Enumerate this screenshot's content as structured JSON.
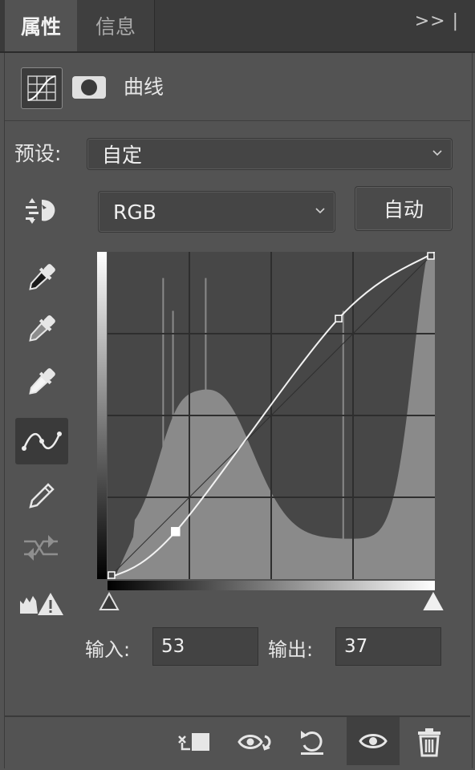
{
  "tabs": [
    {
      "label": "属性",
      "active": true
    },
    {
      "label": "信息",
      "active": false
    }
  ],
  "panel_menu_label": ">> |",
  "adjustment": {
    "title": "曲线",
    "type_icon": "curves-adjustment-icon",
    "mask_icon": "layer-mask-icon"
  },
  "preset": {
    "label": "预设:",
    "value": "自定"
  },
  "channel": {
    "value": "RGB",
    "auto_label": "自动"
  },
  "tools": [
    {
      "name": "on-image-adjust-icon",
      "active": false
    },
    {
      "name": "black-point-eyedropper-icon",
      "active": false
    },
    {
      "name": "gray-point-eyedropper-icon",
      "active": false
    },
    {
      "name": "white-point-eyedropper-icon",
      "active": false
    },
    {
      "name": "edit-points-curve-icon",
      "active": true
    },
    {
      "name": "pencil-draw-icon",
      "active": false
    },
    {
      "name": "smooth-curve-icon",
      "active": false
    },
    {
      "name": "clipping-warning-icon",
      "active": false
    }
  ],
  "curve": {
    "input_range": [
      0,
      255
    ],
    "output_range": [
      0,
      255
    ],
    "points": [
      {
        "input": 0,
        "output": 0
      },
      {
        "input": 53,
        "output": 37,
        "selected": true
      },
      {
        "input": 180,
        "output": 203
      },
      {
        "input": 255,
        "output": 255
      }
    ]
  },
  "input_output": {
    "input_label": "输入:",
    "input_value": "53",
    "output_label": "输出:",
    "output_value": "37"
  },
  "bottom_icons": [
    "clip-to-layer-icon",
    "view-previous-state-icon",
    "reset-adjustment-icon",
    "toggle-visibility-icon",
    "delete-adjustment-icon"
  ],
  "colors": {
    "panel_bg": "#535353",
    "graph_bg": "#474747",
    "histogram": "#8a8a8a",
    "curve": "#f2f2f2"
  }
}
